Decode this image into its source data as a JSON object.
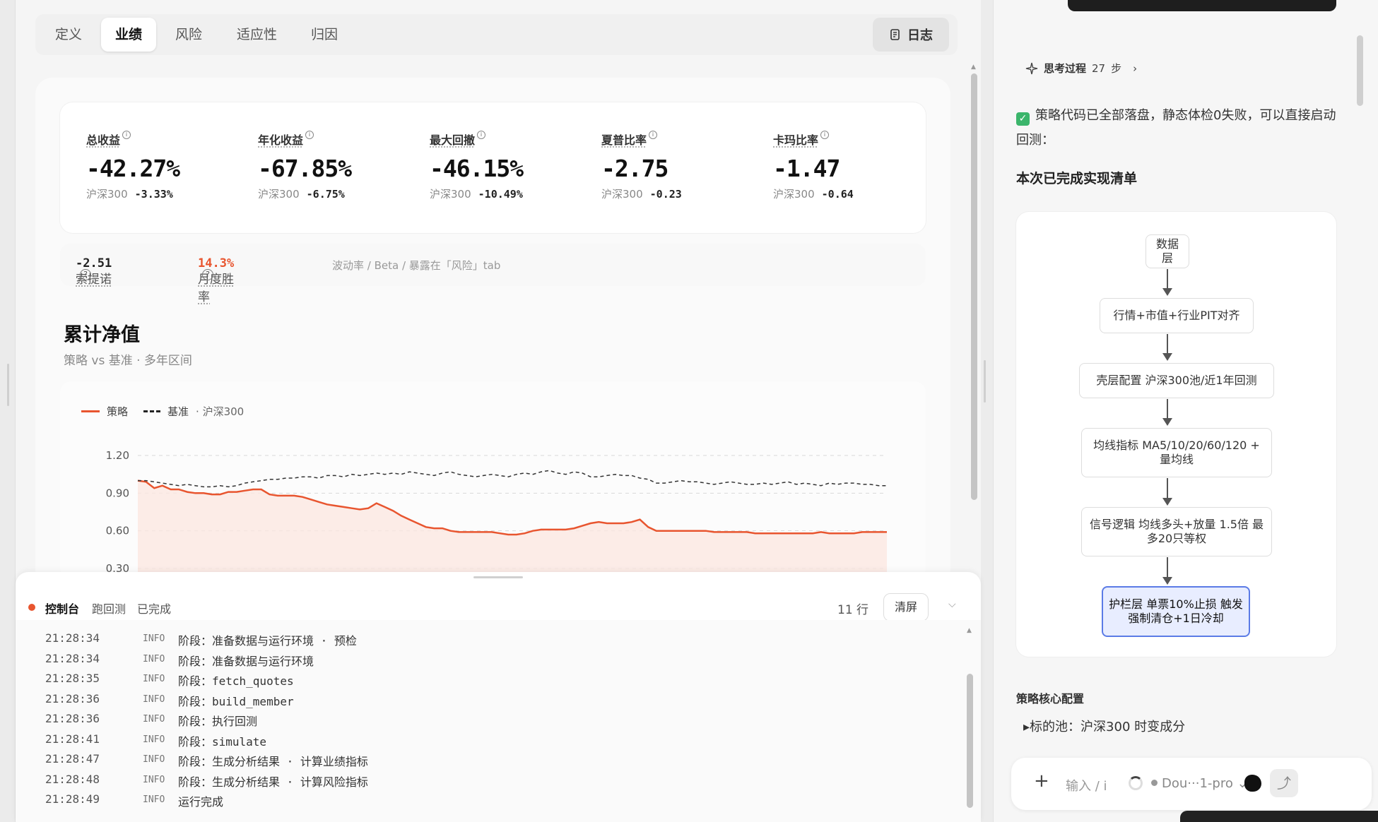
{
  "tabs": [
    {
      "label": "定义"
    },
    {
      "label": "业绩"
    },
    {
      "label": "风险"
    },
    {
      "label": "适应性"
    },
    {
      "label": "归因"
    }
  ],
  "log_button": "日志",
  "metrics": [
    {
      "label": "总收益",
      "value": "-42.27%",
      "bench_label": "沪深300",
      "bench": "-3.33%"
    },
    {
      "label": "年化收益",
      "value": "-67.85%",
      "bench_label": "沪深300",
      "bench": "-6.75%"
    },
    {
      "label": "最大回撤",
      "value": "-46.15%",
      "bench_label": "沪深300",
      "bench": "-10.49%"
    },
    {
      "label": "夏普比率",
      "value": "-2.75",
      "bench_label": "沪深300",
      "bench": "-0.23"
    },
    {
      "label": "卡玛比率",
      "value": "-1.47",
      "bench_label": "沪深300",
      "bench": "-0.64"
    }
  ],
  "sub_metrics": {
    "sortino_label": "索提诺",
    "sortino": "-2.51",
    "winrate_label": "月度胜率",
    "winrate": "14.3%",
    "note": "波动率 / Beta / 暴露在「风险」tab"
  },
  "chart_header": {
    "title": "累计净值",
    "subtitle": "策略 vs 基准 · 多年区间"
  },
  "chart_legend": {
    "strategy": "策略",
    "benchmark": "基准",
    "benchmark_name": "· 沪深300"
  },
  "chart_data": {
    "type": "line",
    "yticks": [
      "1.20",
      "0.90",
      "0.60",
      "0.30"
    ],
    "ylim": [
      0.3,
      1.2
    ],
    "grid": true,
    "series": [
      {
        "name": "策略",
        "color": "#e8552f",
        "fill": true,
        "values": [
          1.0,
          0.99,
          0.94,
          0.96,
          0.93,
          0.93,
          0.91,
          0.9,
          0.9,
          0.89,
          0.89,
          0.91,
          0.91,
          0.92,
          0.93,
          0.93,
          0.89,
          0.88,
          0.88,
          0.88,
          0.87,
          0.85,
          0.83,
          0.81,
          0.8,
          0.79,
          0.78,
          0.77,
          0.78,
          0.82,
          0.79,
          0.76,
          0.72,
          0.69,
          0.66,
          0.63,
          0.62,
          0.62,
          0.6,
          0.59,
          0.59,
          0.59,
          0.59,
          0.59,
          0.58,
          0.57,
          0.57,
          0.58,
          0.6,
          0.61,
          0.61,
          0.61,
          0.61,
          0.62,
          0.64,
          0.66,
          0.67,
          0.66,
          0.66,
          0.66,
          0.67,
          0.69,
          0.63,
          0.6,
          0.6,
          0.6,
          0.6,
          0.6,
          0.6,
          0.6,
          0.59,
          0.59,
          0.59,
          0.59,
          0.59,
          0.58,
          0.58,
          0.58,
          0.58,
          0.58,
          0.58,
          0.58,
          0.58,
          0.59,
          0.58,
          0.58,
          0.58,
          0.58,
          0.59,
          0.59,
          0.59,
          0.59
        ]
      },
      {
        "name": "基准",
        "color": "#333333",
        "dashed": true,
        "values": [
          1.0,
          1.0,
          0.99,
          0.98,
          0.97,
          0.96,
          0.97,
          0.96,
          0.95,
          0.95,
          0.96,
          0.95,
          0.96,
          0.98,
          0.99,
          1.0,
          1.01,
          1.01,
          1.02,
          1.02,
          1.03,
          1.03,
          1.02,
          1.04,
          1.04,
          1.03,
          1.05,
          1.04,
          1.05,
          1.06,
          1.05,
          1.06,
          1.05,
          1.07,
          1.06,
          1.05,
          1.04,
          1.06,
          1.07,
          1.05,
          1.04,
          1.03,
          1.04,
          1.05,
          1.04,
          1.03,
          1.05,
          1.06,
          1.05,
          1.07,
          1.08,
          1.06,
          1.05,
          1.07,
          1.06,
          1.03,
          1.03,
          1.04,
          1.05,
          1.04,
          1.04,
          1.02,
          1.01,
          0.98,
          0.98,
          0.99,
          1.0,
          0.99,
          0.99,
          0.98,
          0.97,
          0.98,
          0.99,
          0.98,
          0.97,
          0.97,
          0.98,
          0.97,
          0.98,
          0.99,
          0.97,
          0.98,
          0.97,
          0.96,
          0.98,
          0.97,
          0.98,
          0.98,
          0.97,
          0.97,
          0.96,
          0.96
        ]
      }
    ]
  },
  "console": {
    "title": "控制台",
    "mode": "跑回测",
    "status": "已完成",
    "lines_count": "11",
    "lines_unit": "行",
    "clear": "清屏"
  },
  "logs": [
    {
      "time": "21:28:34",
      "level": "INFO",
      "msg": "阶段：准备数据与运行环境 · 预检"
    },
    {
      "time": "21:28:34",
      "level": "INFO",
      "msg": "阶段：准备数据与运行环境"
    },
    {
      "time": "21:28:35",
      "level": "INFO",
      "msg": "阶段：fetch_quotes"
    },
    {
      "time": "21:28:36",
      "level": "INFO",
      "msg": "阶段：build_member"
    },
    {
      "time": "21:28:36",
      "level": "INFO",
      "msg": "阶段：执行回测"
    },
    {
      "time": "21:28:41",
      "level": "INFO",
      "msg": "阶段：simulate"
    },
    {
      "time": "21:28:47",
      "level": "INFO",
      "msg": "阶段：生成分析结果 · 计算业绩指标"
    },
    {
      "time": "21:28:48",
      "level": "INFO",
      "msg": "阶段：生成分析结果 · 计算风险指标"
    },
    {
      "time": "21:28:49",
      "level": "INFO",
      "msg": "运行完成"
    }
  ],
  "assistant": {
    "think_label": "思考过程",
    "think_steps": "27",
    "think_unit": "步",
    "message": "策略代码已全部落盘，静态体检0失败，可以直接启动回测：",
    "list_title": "本次已完成实现清单",
    "flow": [
      {
        "text": "数据层"
      },
      {
        "text": "行情+市值+行业PIT对齐"
      },
      {
        "text": "壳层配置 沪深300池/近1年回测"
      },
      {
        "text": "均线指标 MA5/10/20/60/120 + 量均线"
      },
      {
        "text": "信号逻辑 均线多头+放量 1.5倍 最多20只等权"
      },
      {
        "text": "护栏层 单票10%止损 触发强制清仓+1日冷却"
      }
    ],
    "config_title": "策略核心配置",
    "config_item": "▸标的池：沪深300 时变成分",
    "input_placeholder": "输入 / i",
    "model": "Dou···1-pro"
  }
}
